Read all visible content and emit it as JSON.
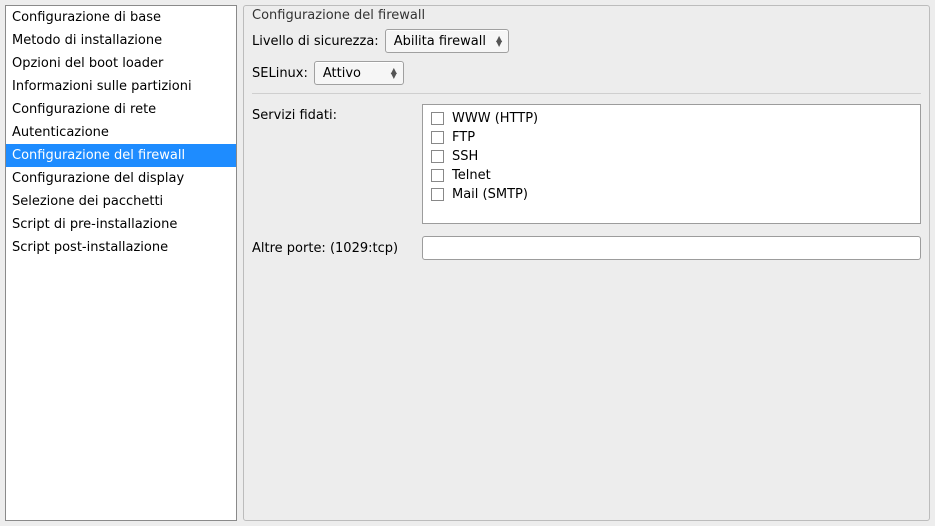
{
  "sidebar": {
    "items": [
      {
        "label": "Configurazione di base"
      },
      {
        "label": "Metodo di installazione"
      },
      {
        "label": "Opzioni del boot loader"
      },
      {
        "label": "Informazioni sulle partizioni"
      },
      {
        "label": "Configurazione di rete"
      },
      {
        "label": "Autenticazione"
      },
      {
        "label": "Configurazione del firewall"
      },
      {
        "label": "Configurazione del display"
      },
      {
        "label": "Selezione dei pacchetti"
      },
      {
        "label": "Script di pre-installazione"
      },
      {
        "label": "Script post-installazione"
      }
    ],
    "selected_index": 6
  },
  "main": {
    "title": "Configurazione del firewall",
    "security_level_label": "Livello di sicurezza:",
    "security_level_value": "Abilita firewall",
    "selinux_label": "SELinux:",
    "selinux_value": "Attivo",
    "trusted_services_label": "Servizi fidati:",
    "services": [
      {
        "label": "WWW (HTTP)",
        "checked": false
      },
      {
        "label": "FTP",
        "checked": false
      },
      {
        "label": "SSH",
        "checked": false
      },
      {
        "label": "Telnet",
        "checked": false
      },
      {
        "label": "Mail (SMTP)",
        "checked": false
      }
    ],
    "other_ports_label": "Altre porte: (1029:tcp)",
    "other_ports_value": ""
  }
}
